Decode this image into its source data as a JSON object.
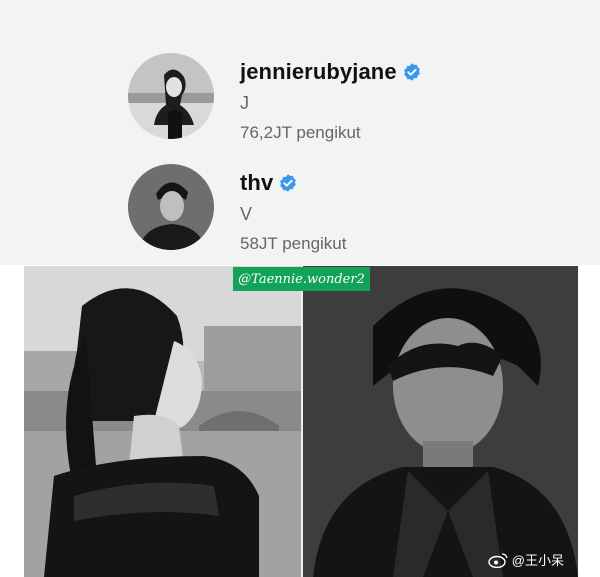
{
  "profiles": [
    {
      "username": "jennierubyjane",
      "full_name": "J",
      "followers": "76,2JT pengikut",
      "verified": true
    },
    {
      "username": "thv",
      "full_name": "V",
      "followers": "58JT pengikut",
      "verified": true
    }
  ],
  "watermark": "@Taennie.wonder2",
  "weibo_handle": "@王小呆",
  "colors": {
    "verified": "#3897f0",
    "watermark_bg": "#12a35a"
  }
}
